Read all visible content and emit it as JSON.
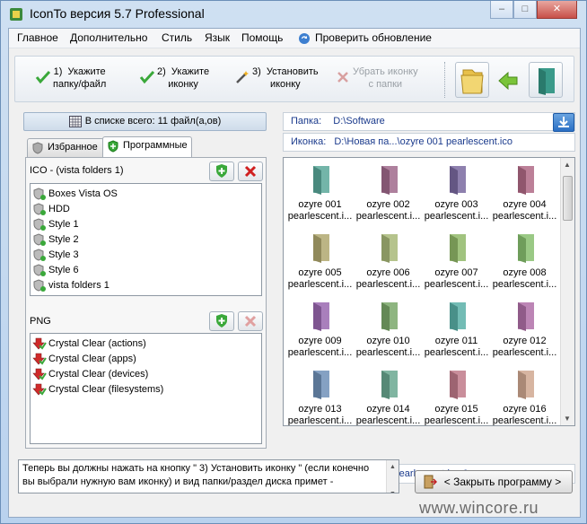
{
  "window": {
    "title": "IconTo версия 5.7 Professional",
    "controls": [
      "–",
      "□",
      "✕"
    ]
  },
  "menu": [
    "Главное",
    "Дополнительно",
    "Стиль",
    "Язык",
    "Помощь",
    "Проверить обновление"
  ],
  "toolbar": {
    "step1": "1)  Укажите\nпапку/файл",
    "step2": "2)  Укажите\nиконку",
    "step3": "3)  Установить\nиконку",
    "remove": "Убрать иконку\nс папки"
  },
  "left": {
    "count": "В списке всего: 11 файл(а,ов)",
    "tabs": [
      "Избранное",
      "Программные"
    ],
    "ico_label": "ICO - (vista folders 1)",
    "ico_items": [
      "Boxes Vista OS",
      "HDD",
      "Style 1",
      "Style 2",
      "Style 3",
      "Style 6",
      "vista folders 1"
    ],
    "png_label": "PNG",
    "png_items": [
      "Crystal Clear (actions)",
      "Crystal Clear (apps)",
      "Crystal Clear (devices)",
      "Crystal Clear (filesystems)"
    ]
  },
  "right": {
    "folder_label": "Папка:",
    "folder_value": "D:\\Software",
    "icon_label": "Иконка:",
    "icon_value": "D:\\Новая па...\\ozyre 001 pearlescent.ico",
    "status_path": "D:\\Новая ...\\ozyre 001 pearlescent.ico,0",
    "icons": [
      {
        "n1": "ozyre 001",
        "n2": "pearlescent.i...",
        "color": "#5aa89a"
      },
      {
        "n1": "ozyre 002",
        "n2": "pearlescent.i...",
        "color": "#a06a8c"
      },
      {
        "n1": "ozyre 003",
        "n2": "pearlescent.i...",
        "color": "#7a6aa0"
      },
      {
        "n1": "ozyre 004",
        "n2": "pearlescent.i...",
        "color": "#b06a86"
      },
      {
        "n1": "ozyre 005",
        "n2": "pearlescent.i...",
        "color": "#b0a870"
      },
      {
        "n1": "ozyre 006",
        "n2": "pearlescent.i...",
        "color": "#a8b878"
      },
      {
        "n1": "ozyre 007",
        "n2": "pearlescent.i...",
        "color": "#90b868"
      },
      {
        "n1": "ozyre 008",
        "n2": "pearlescent.i...",
        "color": "#88c070"
      },
      {
        "n1": "ozyre 009",
        "n2": "pearlescent.i...",
        "color": "#9a68b0"
      },
      {
        "n1": "ozyre 010",
        "n2": "pearlescent.i...",
        "color": "#7aa86a"
      },
      {
        "n1": "ozyre 011",
        "n2": "pearlescent.i...",
        "color": "#5ab0a8"
      },
      {
        "n1": "ozyre 012",
        "n2": "pearlescent.i...",
        "color": "#b070a8"
      },
      {
        "n1": "ozyre 013",
        "n2": "pearlescent.i...",
        "color": "#7090b8"
      },
      {
        "n1": "ozyre 014",
        "n2": "pearlescent.i...",
        "color": "#6aa890"
      },
      {
        "n1": "ozyre 015",
        "n2": "pearlescent.i...",
        "color": "#c07a8a"
      },
      {
        "n1": "ozyre 016",
        "n2": "pearlescent.i...",
        "color": "#d0a890"
      }
    ]
  },
  "message": "Теперь вы должны нажать на кнопку \" 3)  Установить иконку \" (если конечно вы выбрали нужную вам иконку) и вид папки/раздел диска примет -",
  "close_button": "< Закрыть программу >",
  "watermark": "www.wincore.ru"
}
